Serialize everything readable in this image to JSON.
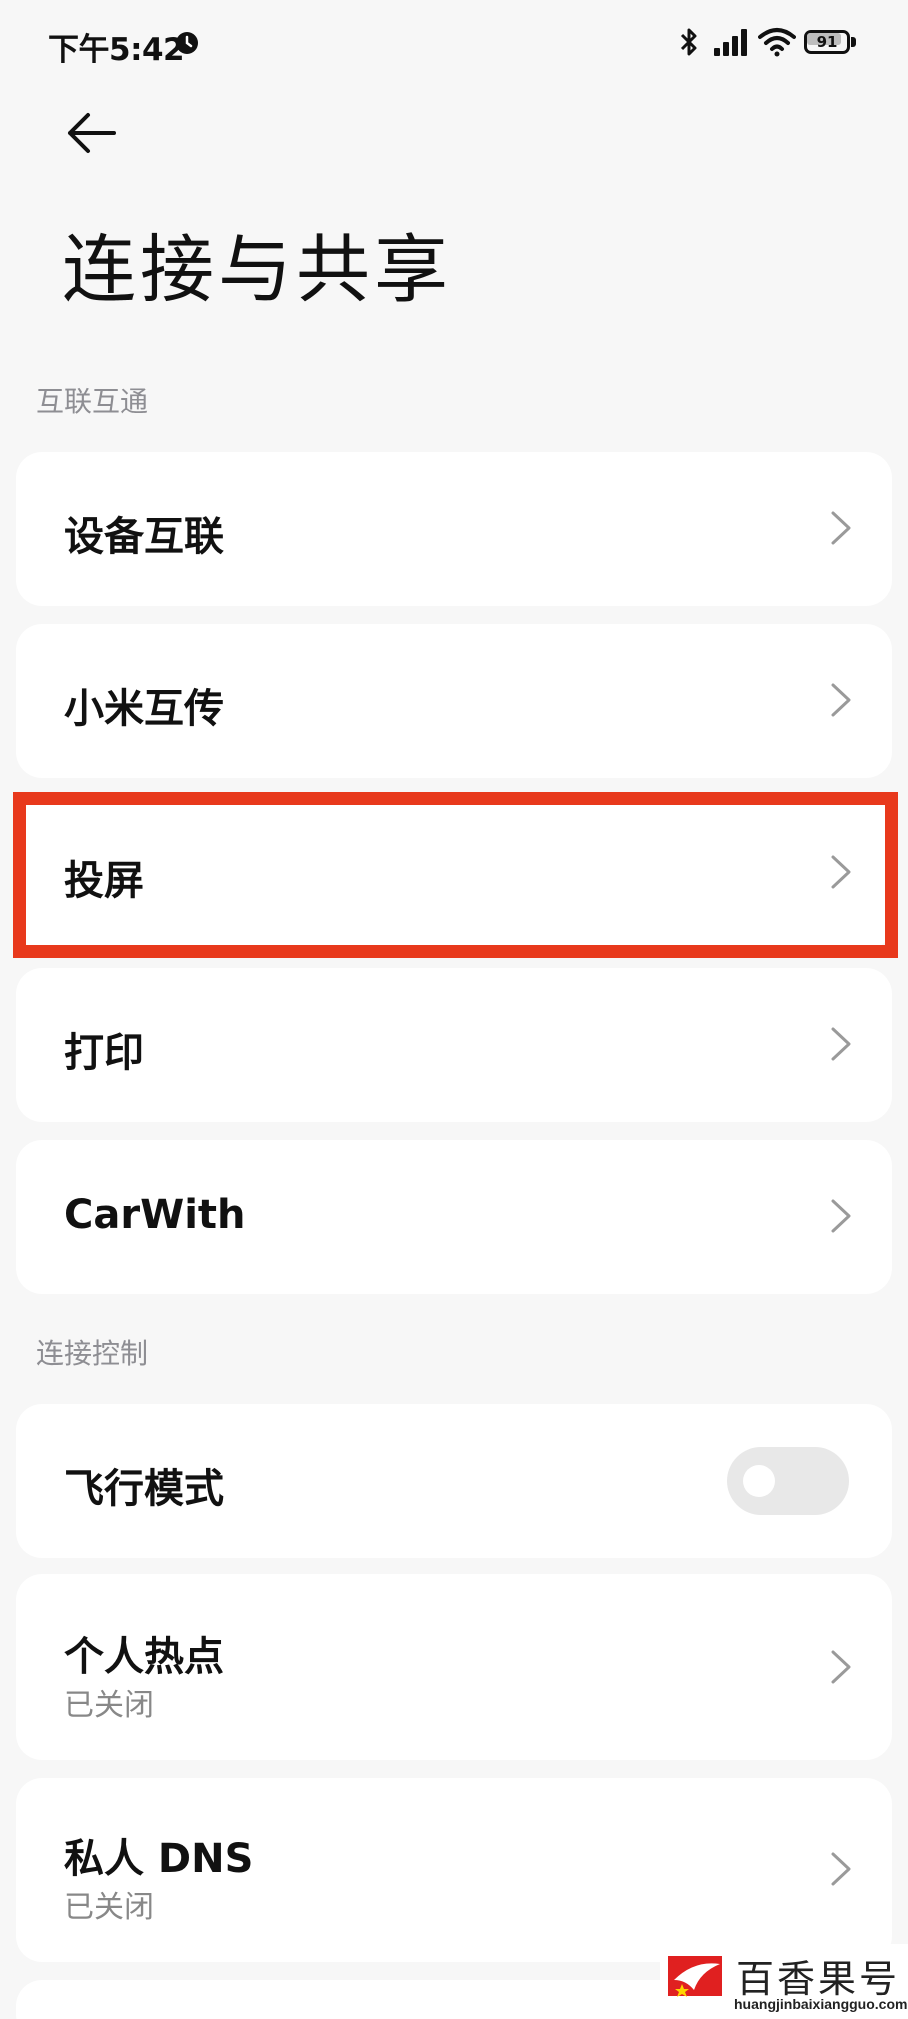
{
  "status_bar": {
    "time": "下午5:42",
    "battery": "91",
    "icons": [
      "alarm-icon",
      "bluetooth-icon",
      "signal-icon",
      "wifi-icon",
      "battery-icon"
    ]
  },
  "header": {
    "back_icon": "arrow-left-icon",
    "title": "连接与共享"
  },
  "sections": [
    {
      "header": "互联互通",
      "items": [
        {
          "label": "设备互联"
        },
        {
          "label": "小米互传"
        },
        {
          "label": "投屏",
          "highlighted": true
        },
        {
          "label": "打印"
        },
        {
          "label": "CarWith"
        }
      ]
    },
    {
      "header": "连接控制",
      "items": [
        {
          "label": "飞行模式",
          "toggle": false
        },
        {
          "label": "个人热点",
          "sublabel": "已关闭"
        },
        {
          "label": "私人 DNS",
          "sublabel": "已关闭"
        }
      ]
    }
  ],
  "watermark": {
    "title": "百香果号",
    "url": "huangjinbaixiangguo.com"
  },
  "colors": {
    "background": "#f7f7f7",
    "card": "#ffffff",
    "highlight": "#e8391c",
    "section_text": "#8e8e93"
  }
}
